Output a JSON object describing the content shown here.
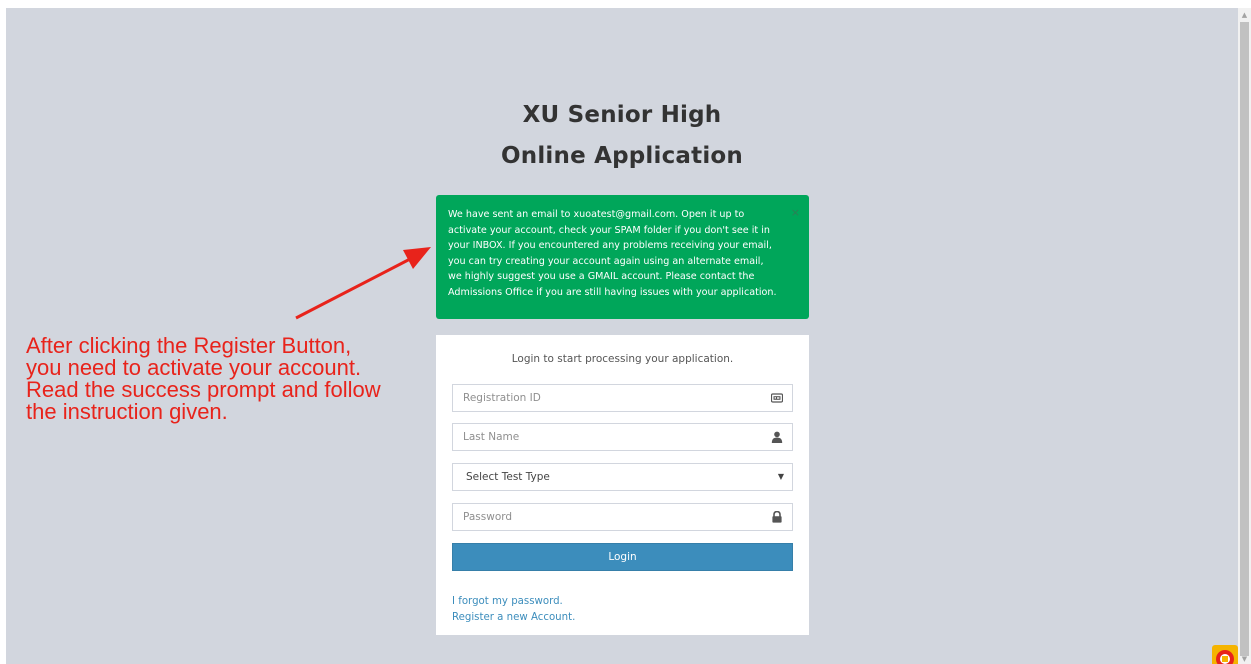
{
  "page": {
    "title_line1": "XU Senior High",
    "title_line2": "Online Application"
  },
  "alert": {
    "message": "We have sent an email to xuoatest@gmail.com. Open it up to activate your account, check your SPAM folder if you don't see it in your INBOX. If you encountered any problems receiving your email, you can try creating your account again using an alternate email, we highly suggest you use a GMAIL account. Please contact the Admissions Office if you are still having issues with your application.",
    "close_label": "×",
    "color": "#00a65a"
  },
  "login": {
    "message": "Login to start processing your application.",
    "registration_id_placeholder": "Registration ID",
    "last_name_placeholder": "Last Name",
    "test_type_selected": "Select Test Type",
    "password_placeholder": "Password",
    "button_label": "Login",
    "button_color": "#3c8dbc",
    "forgot_link": "I forgot my password.",
    "register_link": "Register a new Account.",
    "icons": [
      "id-card-icon",
      "user-icon",
      "caret-down-icon",
      "lock-icon"
    ]
  },
  "annotation": {
    "line1": "After clicking the Register Button,",
    "line2": "you need to activate your account.",
    "line3": "Read the success prompt and follow",
    "line4": "the instruction given.",
    "color": "#e8231b"
  }
}
